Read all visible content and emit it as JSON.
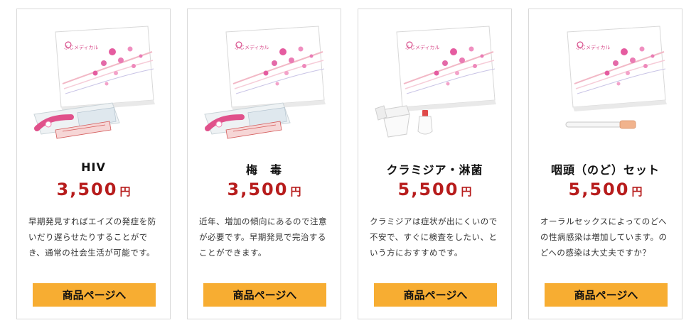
{
  "products": [
    {
      "name": "HIV",
      "price": "3,500",
      "currency": "円",
      "description": "早期発見すればエイズの発症を防いだり遅らせたりすることができ、通常の社会生活が可能です。",
      "button_label": "商品ページへ",
      "image_icon": "kit-box-with-swab-icon",
      "box_brand": "ふじメディカル"
    },
    {
      "name": "梅　毒",
      "price": "3,500",
      "currency": "円",
      "description": "近年、増加の傾向にあるので注意が必要です。早期発見で完治することができます。",
      "button_label": "商品ページへ",
      "image_icon": "kit-box-with-swab-icon",
      "box_brand": "ふじメディカル"
    },
    {
      "name": "クラミジア・淋菌",
      "price": "5,500",
      "currency": "円",
      "description": "クラミジアは症状が出にくいので不安で、すぐに検査をしたい、という方におすすめです。",
      "button_label": "商品ページへ",
      "image_icon": "kit-box-with-cup-icon",
      "box_brand": "ふじメディカル"
    },
    {
      "name": "咽頭（のど）セット",
      "price": "5,500",
      "currency": "円",
      "description": "オーラルセックスによってのどへの性病感染は増加しています。のどへの感染は大丈夫ですか？",
      "button_label": "商品ページへ",
      "image_icon": "kit-box-with-tube-icon",
      "box_brand": "ふじメディカル"
    }
  ],
  "colors": {
    "price": "#b71c1c",
    "button": "#f7ad32",
    "card_border": "#d9d9d9"
  }
}
